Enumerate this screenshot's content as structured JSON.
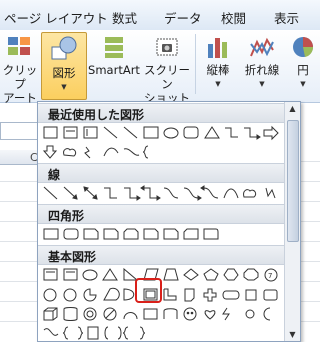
{
  "tabs": [
    "ページ レイアウト",
    "数式",
    "データ",
    "校閲",
    "表示"
  ],
  "ribbon": {
    "clipart": [
      "クリップ",
      "アート"
    ],
    "shapes": "図形",
    "smartart": "SmartArt",
    "screenshot": [
      "スクリーン",
      "ショット"
    ],
    "bar_chart": "縦棒",
    "line_chart": "折れ線",
    "pie_chart": "円"
  },
  "sheet": {
    "column_label": "C"
  },
  "gallery": {
    "categories": [
      "最近使用した図形",
      "線",
      "四角形",
      "基本図形"
    ]
  },
  "colors": {
    "selection": "#d9201a",
    "shape_button": "#fbcf5f"
  }
}
